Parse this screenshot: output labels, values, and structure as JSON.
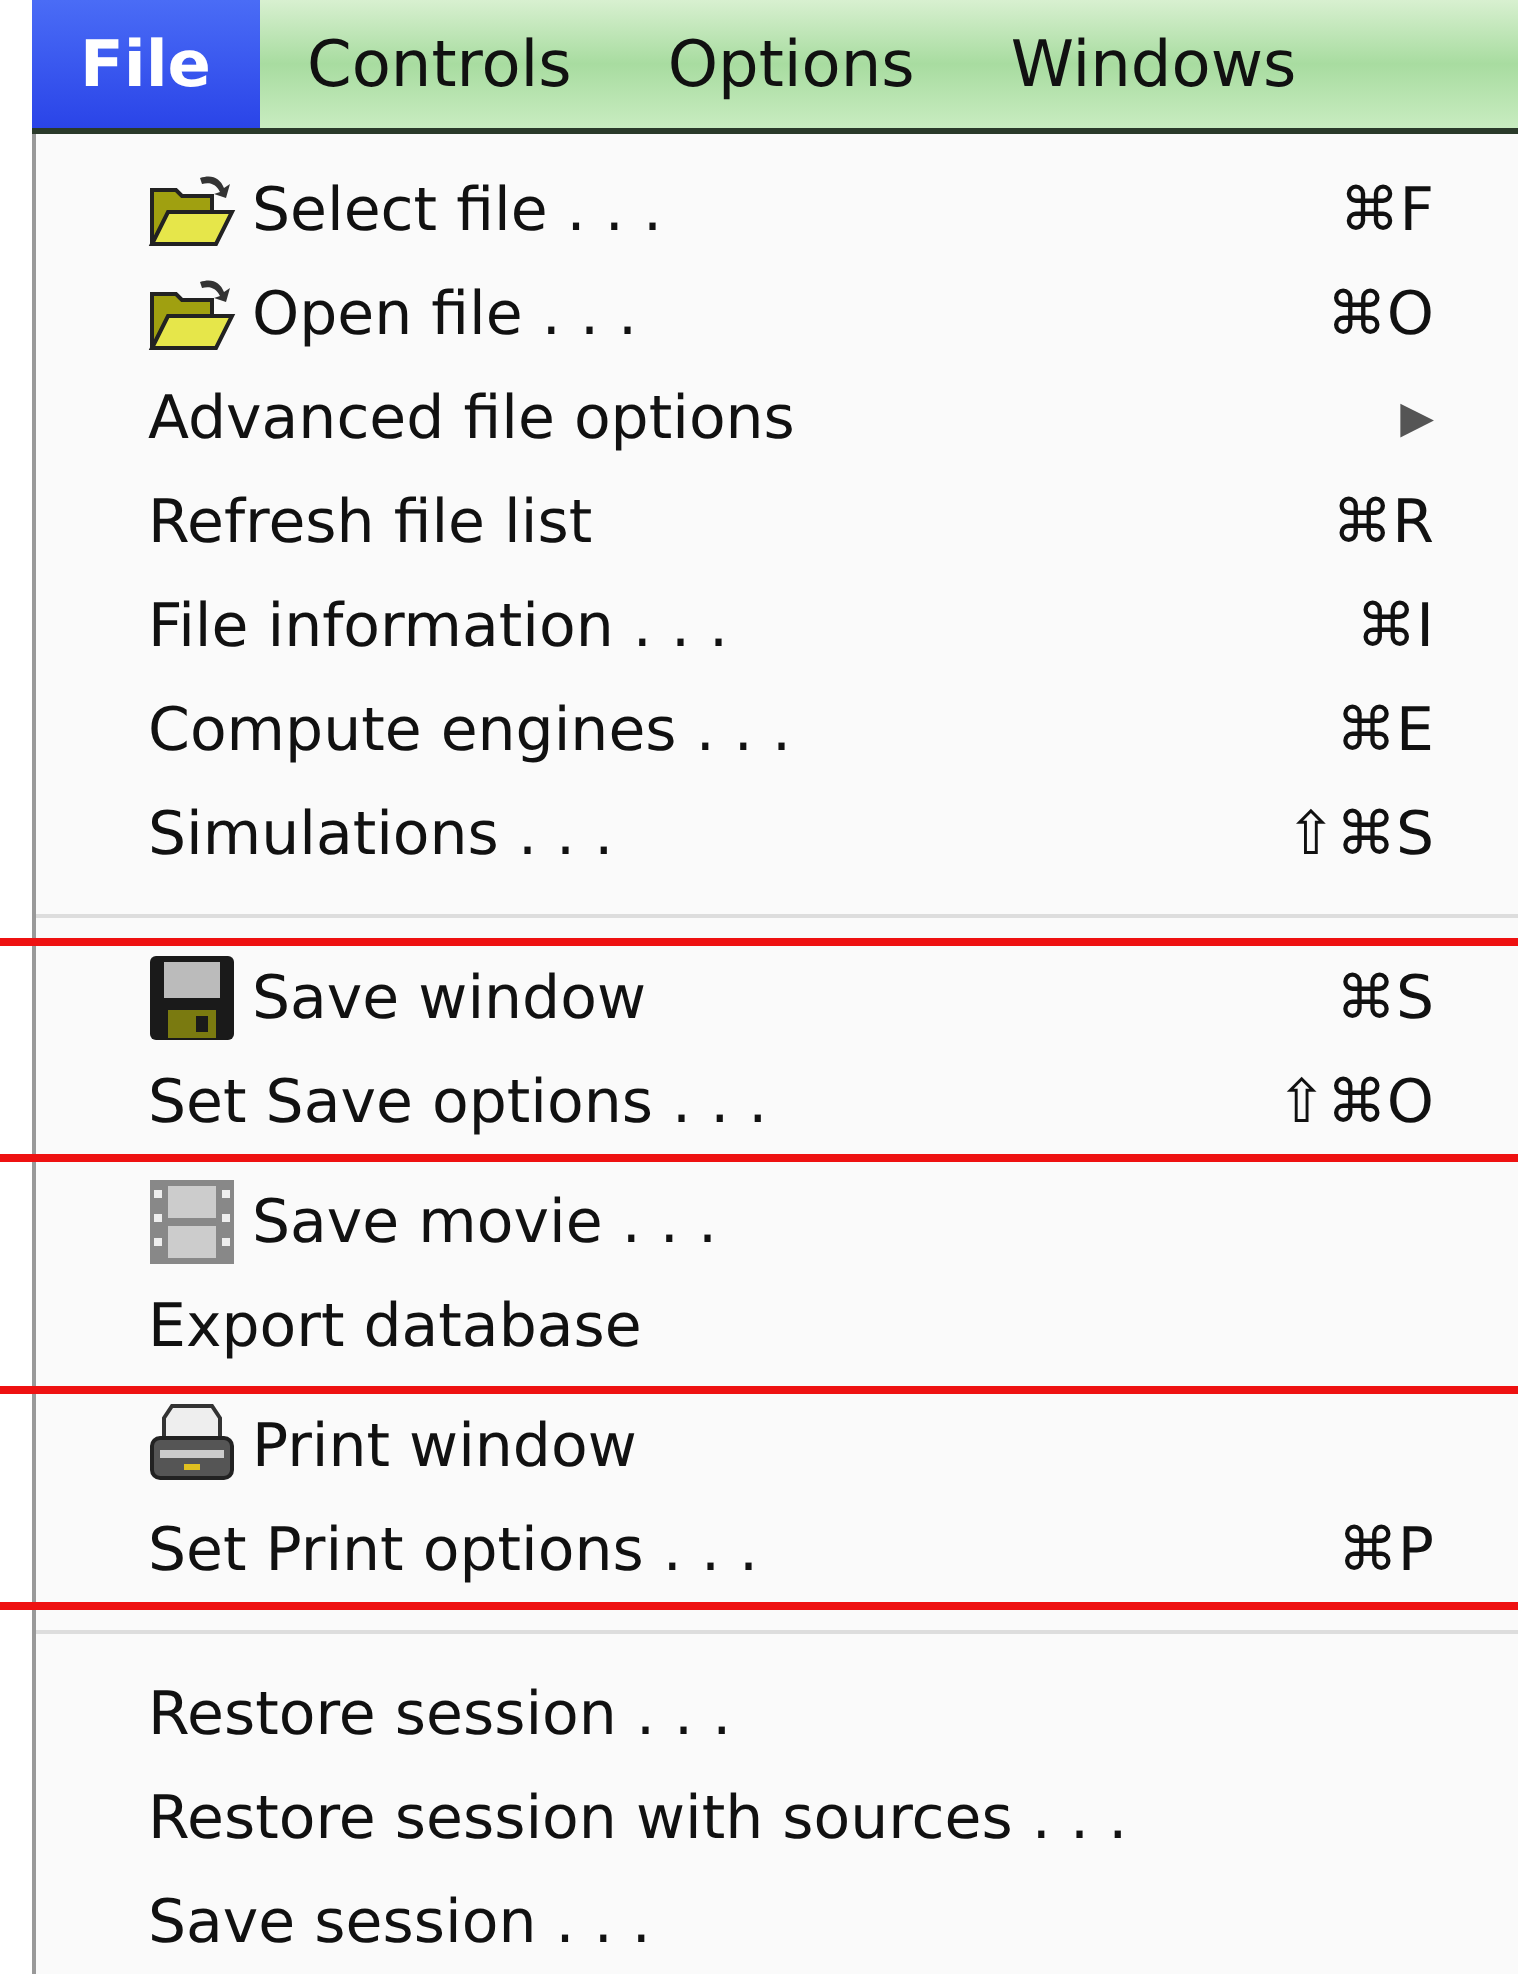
{
  "menu_bar": [
    {
      "label": "File",
      "selected": true
    },
    {
      "label": "Controls",
      "selected": false
    },
    {
      "label": "Options",
      "selected": false
    },
    {
      "label": "Windows",
      "selected": false
    }
  ],
  "menu": {
    "sections": [
      {
        "blocks": [
          {
            "outlined": false,
            "items": [
              {
                "kind": "open",
                "label": "Select file . . .",
                "shortcut": "⌘F"
              },
              {
                "kind": "open",
                "label": "Open file . . .",
                "shortcut": "⌘O"
              },
              {
                "kind": "plain",
                "label": "Advanced file options",
                "submenu": "▶"
              },
              {
                "kind": "plain",
                "label": "Refresh file list",
                "shortcut": "⌘R"
              },
              {
                "kind": "plain",
                "label": "File information . . .",
                "shortcut": "⌘I"
              },
              {
                "kind": "plain",
                "label": "Compute engines . . .",
                "shortcut": "⌘E"
              },
              {
                "kind": "plain",
                "label": "Simulations . . .",
                "shortcut": "⇧⌘S"
              }
            ]
          }
        ]
      },
      {
        "blocks": [
          {
            "outlined": true,
            "items": [
              {
                "kind": "save",
                "label": "Save window",
                "shortcut": "⌘S"
              },
              {
                "kind": "plain",
                "label": "Set Save options . . .",
                "shortcut": "⇧⌘O"
              }
            ]
          },
          {
            "outlined": false,
            "items": [
              {
                "kind": "movie",
                "label": "Save movie . . ."
              },
              {
                "kind": "plain",
                "label": "Export database"
              }
            ]
          },
          {
            "outlined": true,
            "items": [
              {
                "kind": "print",
                "label": "Print window"
              },
              {
                "kind": "plain",
                "label": "Set Print options . . .",
                "shortcut": "⌘P"
              }
            ]
          }
        ]
      },
      {
        "blocks": [
          {
            "outlined": false,
            "items": [
              {
                "kind": "plain",
                "label": "Restore session . . ."
              },
              {
                "kind": "plain",
                "label": "Restore session with sources . . ."
              },
              {
                "kind": "plain",
                "label": "Save session . . ."
              }
            ]
          }
        ]
      }
    ]
  }
}
